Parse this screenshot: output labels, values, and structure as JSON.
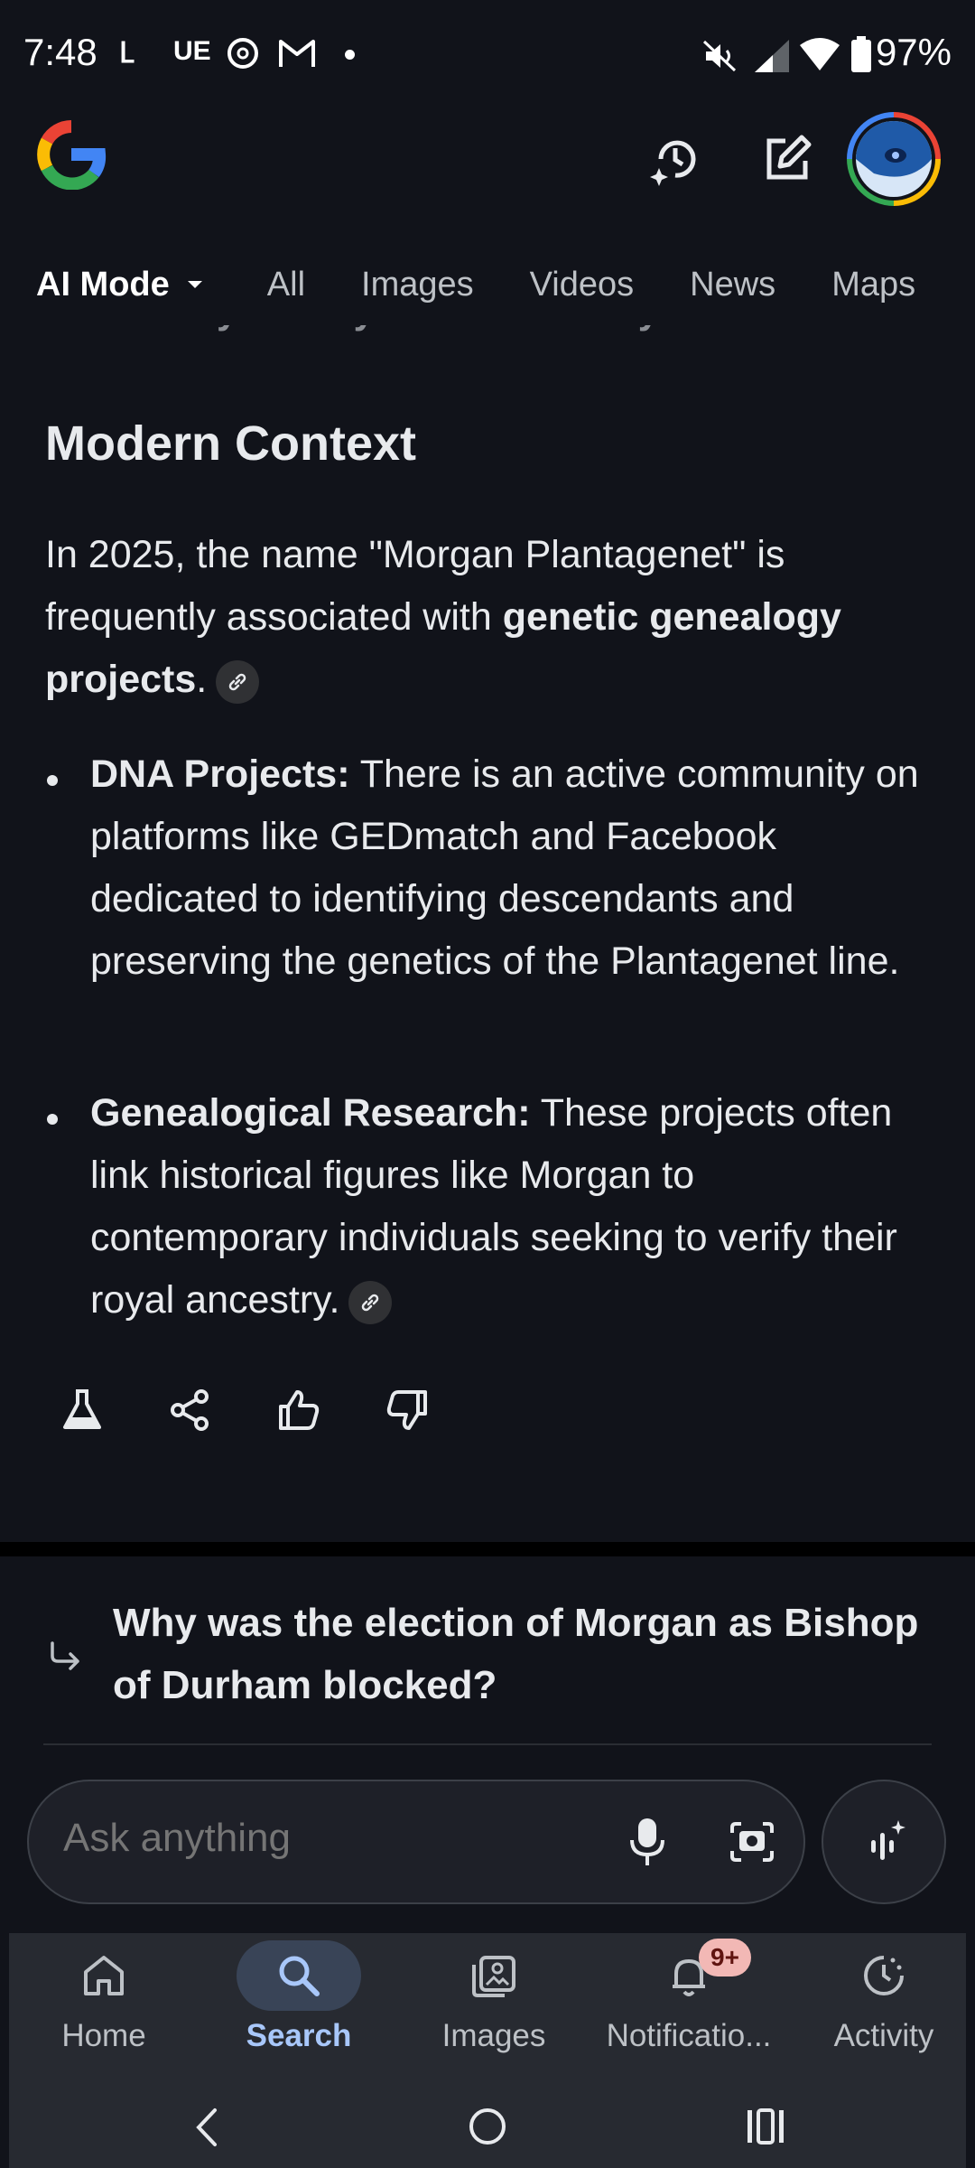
{
  "status_bar": {
    "time": "7:48",
    "carrier_glyphs": [
      "Ⳑ",
      "UE"
    ],
    "battery": "97%"
  },
  "header": {
    "logo_letter": "G",
    "colors": {
      "blue": "#4285F4",
      "red": "#EA4335",
      "yellow": "#FBBC05",
      "green": "#34A853"
    }
  },
  "tabs": [
    {
      "label": "AI Mode",
      "active": true
    },
    {
      "label": "All"
    },
    {
      "label": "Images"
    },
    {
      "label": "Videos"
    },
    {
      "label": "News"
    },
    {
      "label": "Maps"
    }
  ],
  "content": {
    "clipped_line": "not defy the royal father for any reason",
    "section_title": "Modern Context",
    "intro_plain": "In 2025, the name \"Morgan Plantagenet\" is frequently associated with ",
    "intro_bold": "genetic genealogy projects",
    "intro_end": ".",
    "bullets": [
      {
        "label": "DNA Projects:",
        "text": " There is an active community on platforms like GEDmatch and Facebook dedicated to identifying descendants and preserving the genetics of the Plantagenet line."
      },
      {
        "label": "Genealogical Research:",
        "text": " These projects often link historical figures like Morgan to contemporary individuals seeking to verify their royal ancestry."
      }
    ]
  },
  "followup": {
    "question": "Why was the election of Morgan as Bishop of Durham blocked?"
  },
  "ask_bar": {
    "placeholder": "Ask anything"
  },
  "bottom_nav": {
    "items": [
      {
        "label": "Home"
      },
      {
        "label": "Search",
        "active": true
      },
      {
        "label": "Images"
      },
      {
        "label": "Notificatio..."
      },
      {
        "label": "Activity"
      }
    ],
    "notification_badge": "9+",
    "active_color": "#a8c7fa"
  }
}
